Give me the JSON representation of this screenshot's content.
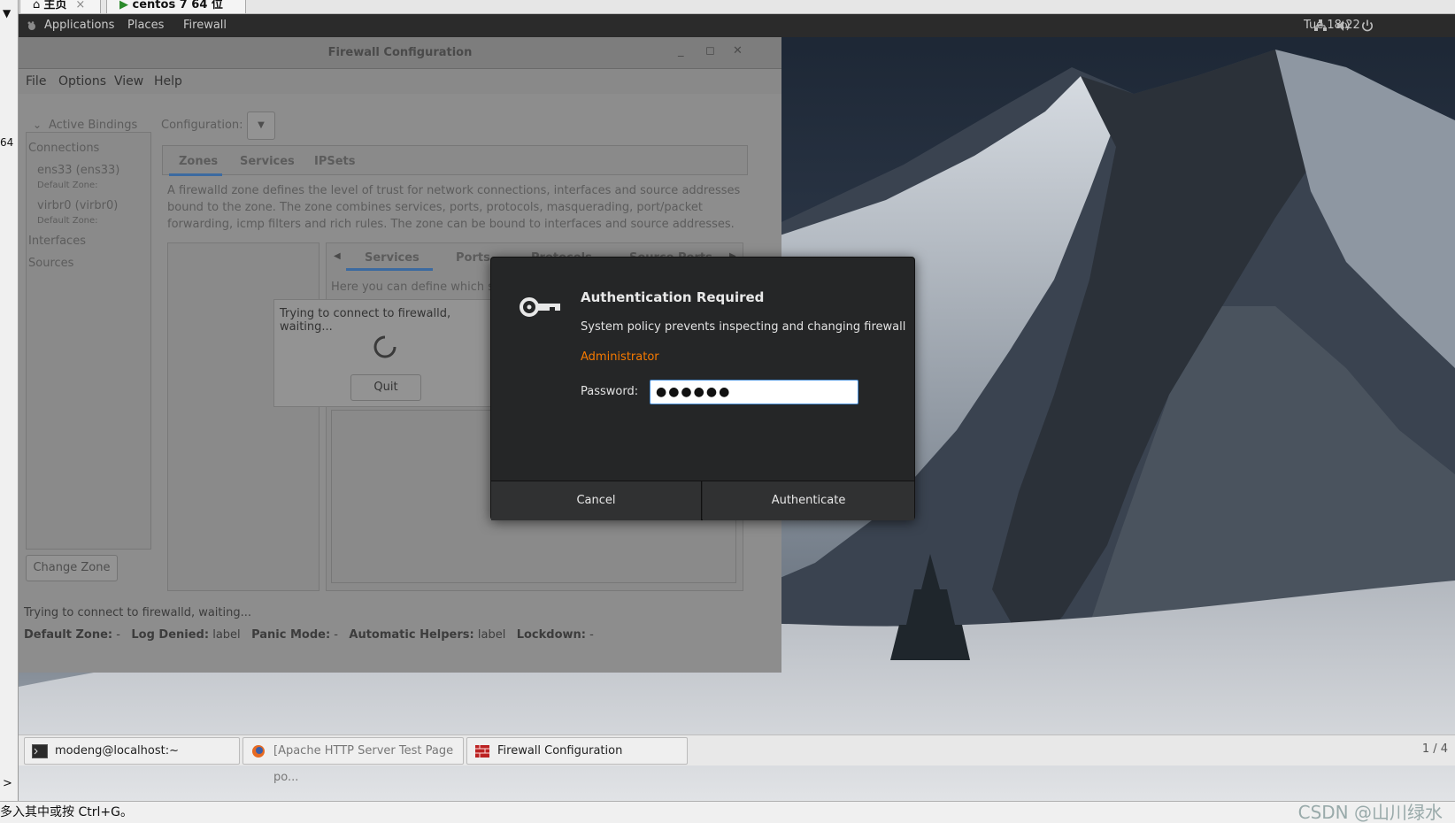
{
  "host": {
    "tabs": [
      {
        "label": "主页"
      },
      {
        "label": "centos 7 64 位"
      }
    ],
    "left_number": "64",
    "status_text": "多入其中或按 Ctrl+G。",
    "watermark": "CSDN @山川绿水"
  },
  "topbar": {
    "applications": "Applications",
    "places": "Places",
    "firewall": "Firewall",
    "clock": "Tue 18:22"
  },
  "firewall_window": {
    "title": "Firewall Configuration",
    "menu": [
      "File",
      "Options",
      "View",
      "Help"
    ],
    "active_bindings": "Active Bindings",
    "configuration_label": "Configuration:",
    "connections_header": "Connections",
    "connections": [
      {
        "name": "ens33 (ens33)",
        "zone": "Default Zone:"
      },
      {
        "name": "virbr0 (virbr0)",
        "zone": "Default Zone:"
      }
    ],
    "interfaces": "Interfaces",
    "sources": "Sources",
    "change_zone": "Change Zone",
    "top_tabs": [
      "Zones",
      "Services",
      "IPSets"
    ],
    "zone_description": "A firewalld zone defines the level of trust for network connections, interfaces and source addresses bound to the zone. The zone combines services, ports, protocols, masquerading, port/packet forwarding, icmp filters and rich rules. The zone can be bound to interfaces and source addresses.",
    "sub_tabs": [
      "Services",
      "Ports",
      "Protocols",
      "Source Ports"
    ],
    "services_hint": "Here you can define which se",
    "connecting_text": "Trying to connect to firewalld, waiting...",
    "quit_button": "Quit",
    "status_line": "Trying to connect to firewalld, waiting...",
    "status_fields": [
      {
        "key": "Default Zone:",
        "value": "-"
      },
      {
        "key": "Log Denied:",
        "value": "label"
      },
      {
        "key": "Panic Mode:",
        "value": "-"
      },
      {
        "key": "Automatic Helpers:",
        "value": "label"
      },
      {
        "key": "Lockdown:",
        "value": "-"
      }
    ]
  },
  "auth_dialog": {
    "title": "Authentication Required",
    "message": "System policy prevents inspecting and changing firewall",
    "user": "Administrator",
    "password_label": "Password:",
    "password_value": "●●●●●●",
    "cancel": "Cancel",
    "authenticate": "Authenticate",
    "user_color": "#f57900"
  },
  "taskbar": {
    "tasks": [
      {
        "label": "modeng@localhost:~",
        "icon": "terminal-icon"
      },
      {
        "label": "[Apache HTTP Server Test Page po...",
        "icon": "firefox-icon"
      },
      {
        "label": "Firewall Configuration",
        "icon": "firewall-icon"
      }
    ],
    "pager": "1 / 4"
  }
}
